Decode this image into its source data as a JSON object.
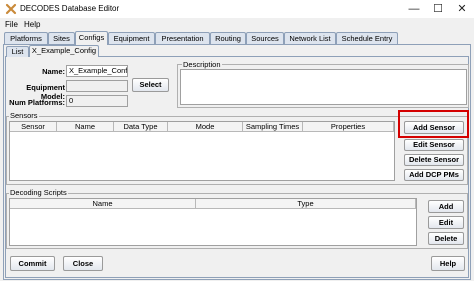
{
  "window": {
    "title": "DECODES Database Editor",
    "controls": {
      "minimize": "—",
      "maximize": "☐",
      "close": "✕"
    }
  },
  "menu": [
    "File",
    "Help"
  ],
  "tabs": [
    "Platforms",
    "Sites",
    "Configs",
    "Equipment",
    "Presentation",
    "Routing",
    "Sources",
    "Network List",
    "Schedule Entry"
  ],
  "active_tab": "Configs",
  "subtabs": [
    "List",
    "X_Example_Config"
  ],
  "active_subtab": "X_Example_Config",
  "form": {
    "name_label": "Name:",
    "name_value": "X_Example_Config",
    "equipment_label": "Equipment Model:",
    "equipment_value": "",
    "select_button": "Select",
    "num_platforms_label": "Num Platforms:",
    "num_platforms_value": "0",
    "description_label": "Description",
    "description_value": ""
  },
  "sensors": {
    "title": "Sensors",
    "columns": [
      "Sensor",
      "Name",
      "Data Type",
      "Mode",
      "Sampling Times",
      "Properties"
    ],
    "rows": [],
    "buttons": [
      "Add Sensor",
      "Edit Sensor",
      "Delete Sensor",
      "Add DCP PMs"
    ],
    "highlighted_button": "Add Sensor"
  },
  "decoding_scripts": {
    "title": "Decoding Scripts",
    "columns": [
      "Name",
      "Type"
    ],
    "rows": [],
    "buttons": [
      "Add",
      "Edit",
      "Delete"
    ]
  },
  "footer": {
    "commit": "Commit",
    "close": "Close",
    "help": "Help"
  },
  "colors": {
    "highlight": "#d40000",
    "tab_border": "#8ea0b8",
    "app_icon": "#c98a3a"
  }
}
